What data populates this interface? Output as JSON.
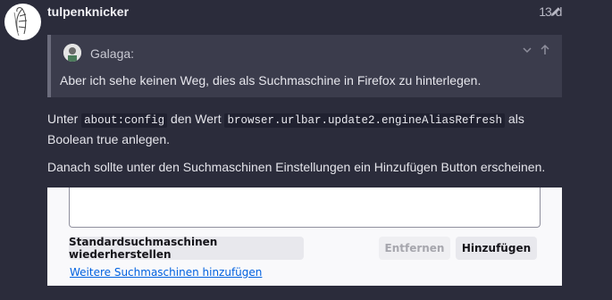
{
  "post": {
    "username": "tulpenknicker",
    "edit_count": "1",
    "date": "3 d"
  },
  "quote": {
    "author": "Galaga:",
    "text": "Aber ich sehe keinen Weg, dies als Suchmaschine in Firefox zu hinterlegen."
  },
  "body": {
    "p1_before": "Unter ",
    "p1_code1": "about:config",
    "p1_mid": " den Wert ",
    "p1_code2": "browser.urlbar.update2.engineAliasRefresh",
    "p1_after": " als Boolean true anlegen.",
    "p2": "Danach sollte unter den Suchmaschinen Einstellungen ein Hinzufügen Button erscheinen."
  },
  "screenshot": {
    "restore_button": "Standardsuchmaschinen wiederherstellen",
    "remove_button": "Entfernen",
    "add_button": "Hinzufügen",
    "more_link": "Weitere Suchmaschinen hinzufügen"
  },
  "icons": {
    "edit": "pencil-icon",
    "collapse": "chevron-down-icon",
    "jump": "arrow-up-icon"
  }
}
